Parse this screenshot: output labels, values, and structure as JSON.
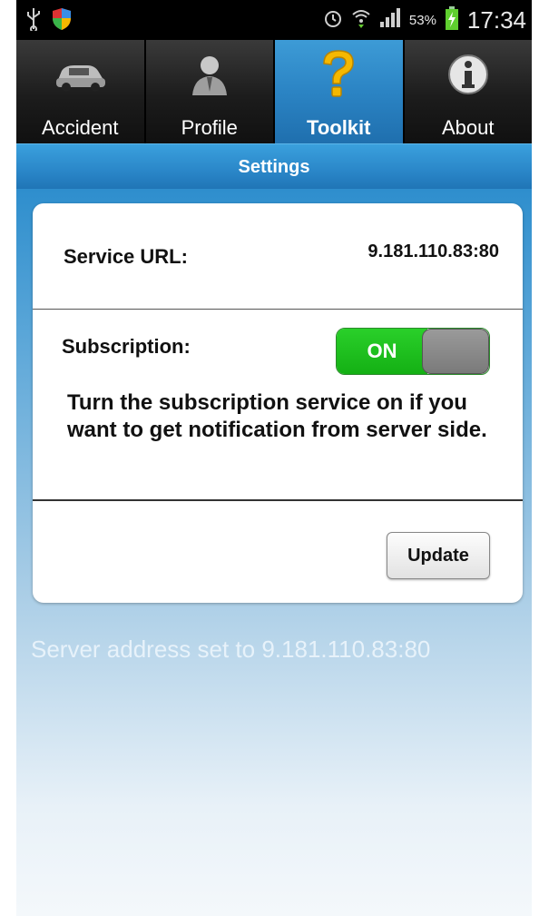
{
  "status_bar": {
    "battery_percent": "53%",
    "time": "17:34",
    "icons": [
      "usb-icon",
      "shield-icon",
      "alarm-icon",
      "wifi-icon",
      "signal-icon",
      "battery-charging-icon"
    ]
  },
  "tabs": [
    {
      "label": "Accident",
      "icon": "car-icon",
      "active": false
    },
    {
      "label": "Profile",
      "icon": "person-icon",
      "active": false
    },
    {
      "label": "Toolkit",
      "icon": "question-icon",
      "active": true
    },
    {
      "label": "About",
      "icon": "info-icon",
      "active": false
    }
  ],
  "header": {
    "title": "Settings"
  },
  "settings": {
    "service_url_label": "Service URL:",
    "service_url_value": "9.181.110.83:80",
    "subscription_label": "Subscription:",
    "subscription_state": "ON",
    "subscription_description": "Turn the subscription service on if you want to get notification from server side.",
    "update_button": "Update"
  },
  "message": "Server address set to 9.181.110.83:80",
  "colors": {
    "accent": "#2b84c4",
    "toggle_on": "#1cbf1c",
    "status_bar": "#000000"
  }
}
